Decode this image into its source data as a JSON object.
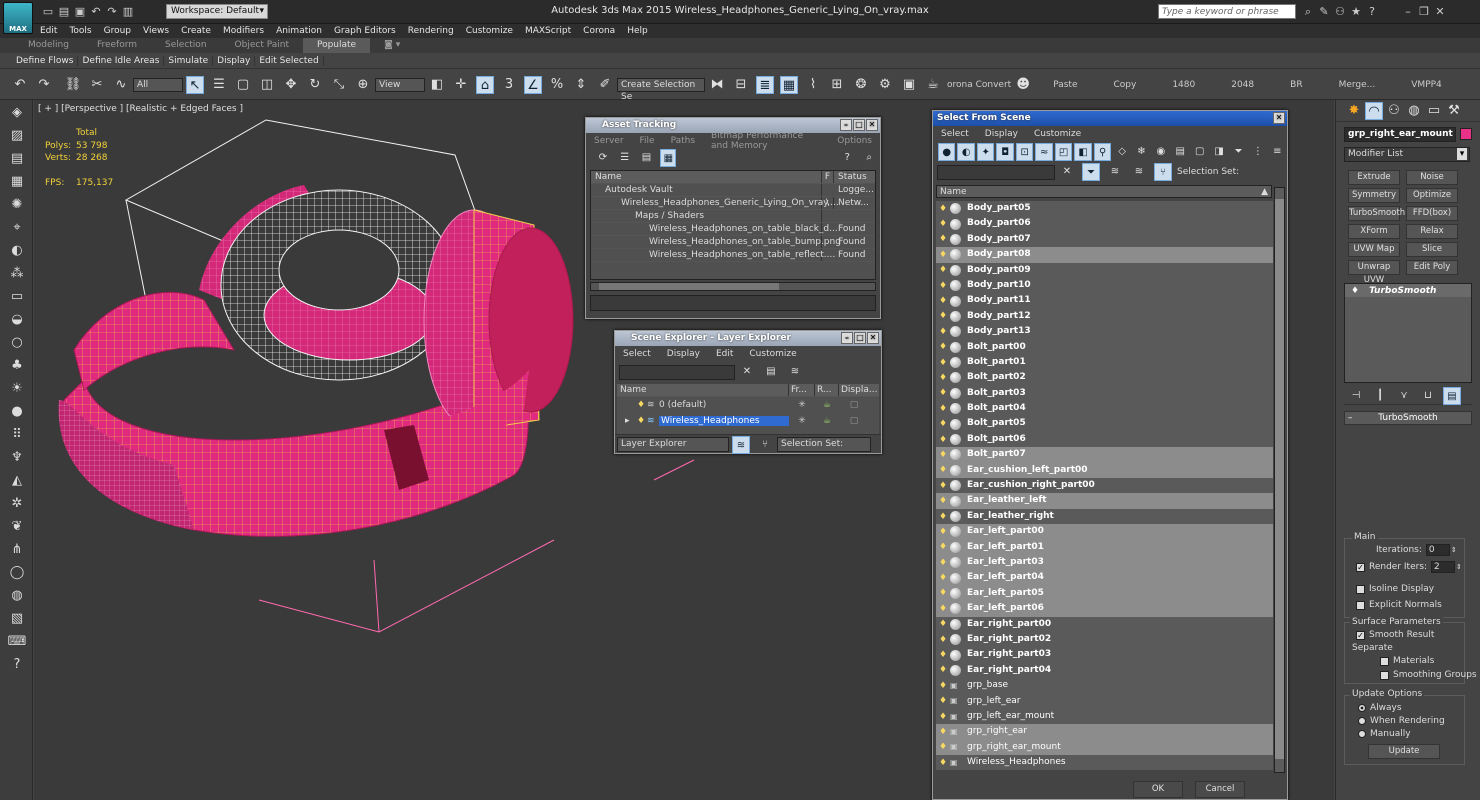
{
  "titlebar": {
    "logo": "MAX",
    "workspace": "Workspace: Default",
    "title": "Autodesk 3ds Max  2015     Wireless_Headphones_Generic_Lying_On_vray.max",
    "search_placeholder": "Type a keyword or phrase"
  },
  "menu": [
    "Edit",
    "Tools",
    "Group",
    "Views",
    "Create",
    "Modifiers",
    "Animation",
    "Graph Editors",
    "Rendering",
    "Customize",
    "MAXScript",
    "Corona",
    "Help"
  ],
  "ribbon_tabs": [
    "Modeling",
    "Freeform",
    "Selection",
    "Object Paint",
    "Populate"
  ],
  "ribbon_active": "Populate",
  "ribbon_row": [
    "Define Flows",
    "Define Idle Areas",
    "Simulate",
    "Display",
    "Edit Selected"
  ],
  "toolbar": {
    "filter": "All",
    "refcoord": "View",
    "named_sel": "Create Selection Se",
    "corona": "orona Convert",
    "texts": [
      "Paste",
      "Copy",
      "1480",
      "2048",
      "BR",
      "Merge...",
      "VMPP4"
    ]
  },
  "viewport": {
    "label": "[ + ] [Perspective ] [Realistic + Edged Faces ]",
    "stats": {
      "total": "Total",
      "polys_label": "Polys:",
      "polys": "53 798",
      "verts_label": "Verts:",
      "verts": "28 268",
      "fps_label": "FPS:",
      "fps": "175,137"
    }
  },
  "asset_tracking": {
    "title": "Asset Tracking",
    "menu": [
      "Server",
      "File",
      "Paths",
      "Bitmap Performance and Memory",
      "Options"
    ],
    "col_name": "Name",
    "col_f": "F",
    "col_status": "Status",
    "rows": [
      {
        "name": "Autodesk Vault",
        "f": "",
        "status": "Logge..."
      },
      {
        "name": "Wireless_Headphones_Generic_Lying_On_vray....",
        "f": "\\",
        "status": "Netw..."
      },
      {
        "name": "Maps / Shaders",
        "f": "",
        "status": ""
      },
      {
        "name": "Wireless_Headphones_on_table_black_d...",
        "f": "",
        "status": "Found"
      },
      {
        "name": "Wireless_Headphones_on_table_bump.png",
        "f": "",
        "status": "Found"
      },
      {
        "name": "Wireless_Headphones_on_table_reflect....",
        "f": "",
        "status": "Found"
      }
    ]
  },
  "scene_explorer": {
    "title": "Scene Explorer - Layer Explorer",
    "menu": [
      "Select",
      "Display",
      "Edit",
      "Customize"
    ],
    "cols": [
      "Name",
      "Fr...",
      "R...",
      "Displa..."
    ],
    "rows": [
      "0 (default)",
      "Wireless_Headphones"
    ],
    "footer_left": "Layer Explorer",
    "footer_right": "Selection Set:"
  },
  "select_from_scene": {
    "title": "Select From Scene",
    "menu": [
      "Select",
      "Display",
      "Customize"
    ],
    "selection_set": "Selection Set:",
    "col_name": "Name",
    "ok": "OK",
    "cancel": "Cancel",
    "items": [
      {
        "n": "Body_part05",
        "s": "unsel",
        "g": false
      },
      {
        "n": "Body_part06",
        "s": "unsel",
        "g": false
      },
      {
        "n": "Body_part07",
        "s": "unsel",
        "g": false
      },
      {
        "n": "Body_part08",
        "s": "sel",
        "g": false
      },
      {
        "n": "Body_part09",
        "s": "unsel",
        "g": false
      },
      {
        "n": "Body_part10",
        "s": "unsel",
        "g": false
      },
      {
        "n": "Body_part11",
        "s": "unsel",
        "g": false
      },
      {
        "n": "Body_part12",
        "s": "unsel",
        "g": false
      },
      {
        "n": "Body_part13",
        "s": "unsel",
        "g": false
      },
      {
        "n": "Bolt_part00",
        "s": "unsel",
        "g": false
      },
      {
        "n": "Bolt_part01",
        "s": "unsel",
        "g": false
      },
      {
        "n": "Bolt_part02",
        "s": "unsel",
        "g": false
      },
      {
        "n": "Bolt_part03",
        "s": "unsel",
        "g": false
      },
      {
        "n": "Bolt_part04",
        "s": "unsel",
        "g": false
      },
      {
        "n": "Bolt_part05",
        "s": "unsel",
        "g": false
      },
      {
        "n": "Bolt_part06",
        "s": "unsel",
        "g": false
      },
      {
        "n": "Bolt_part07",
        "s": "sel",
        "g": false
      },
      {
        "n": "Ear_cushion_left_part00",
        "s": "sel",
        "g": false
      },
      {
        "n": "Ear_cushion_right_part00",
        "s": "unsel",
        "g": false
      },
      {
        "n": "Ear_leather_left",
        "s": "sel",
        "g": false
      },
      {
        "n": "Ear_leather_right",
        "s": "unsel",
        "g": false
      },
      {
        "n": "Ear_left_part00",
        "s": "sel",
        "g": false
      },
      {
        "n": "Ear_left_part01",
        "s": "sel",
        "g": false
      },
      {
        "n": "Ear_left_part03",
        "s": "sel",
        "g": false
      },
      {
        "n": "Ear_left_part04",
        "s": "sel",
        "g": false
      },
      {
        "n": "Ear_left_part05",
        "s": "sel",
        "g": false
      },
      {
        "n": "Ear_left_part06",
        "s": "sel",
        "g": false
      },
      {
        "n": "Ear_right_part00",
        "s": "unsel",
        "g": false
      },
      {
        "n": "Ear_right_part02",
        "s": "unsel",
        "g": false
      },
      {
        "n": "Ear_right_part03",
        "s": "unsel",
        "g": false
      },
      {
        "n": "Ear_right_part04",
        "s": "unsel",
        "g": false
      },
      {
        "n": "grp_base",
        "s": "unsel",
        "g": true
      },
      {
        "n": "grp_left_ear",
        "s": "unsel",
        "g": true
      },
      {
        "n": "grp_left_ear_mount",
        "s": "unsel",
        "g": true
      },
      {
        "n": "grp_right_ear",
        "s": "sel",
        "g": true
      },
      {
        "n": "grp_right_ear_mount",
        "s": "sel",
        "g": true
      },
      {
        "n": "Wireless_Headphones",
        "s": "unsel",
        "g": true
      }
    ]
  },
  "command_panel": {
    "object_name": "grp_right_ear_mount",
    "modifier_list": "Modifier List",
    "buttons": [
      "Extrude",
      "Noise",
      "Symmetry",
      "Optimize",
      "TurboSmooth",
      "FFD(box)",
      "XForm",
      "Relax",
      "UVW Map",
      "Slice",
      "Unwrap UVW",
      "Edit Poly"
    ],
    "stack_item": "TurboSmooth",
    "rollout": {
      "title": "TurboSmooth",
      "main": "Main",
      "iterations_label": "Iterations:",
      "iterations": "0",
      "render_iters_label": "Render Iters:",
      "render_iters": "2",
      "isoline": "Isoline Display",
      "explicit": "Explicit Normals",
      "surface": "Surface Parameters",
      "smooth_result": "Smooth Result",
      "separate": "Separate",
      "materials": "Materials",
      "smoothing_groups": "Smoothing Groups",
      "update_options": "Update Options",
      "always": "Always",
      "when_rendering": "When Rendering",
      "manually": "Manually",
      "update": "Update"
    }
  },
  "colors": {
    "accent_pink": "#e8328a",
    "wire_yellow": "#f0d040",
    "title_blue": "#a9b4c4",
    "selected_row": "#8c8c8c"
  }
}
